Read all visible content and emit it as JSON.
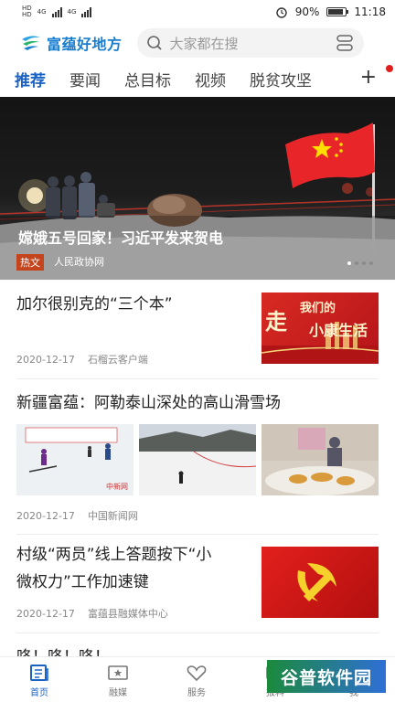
{
  "status_bar": {
    "left_tag_1": "HD",
    "left_tag_2": "HD",
    "left_net_1": "4G",
    "left_net_2": "4G",
    "battery": "90%",
    "time": "11:18"
  },
  "app": {
    "logo_text": "富蕴好地方",
    "search_placeholder": "大家都在搜",
    "icons": {
      "logo": "app-logo",
      "search": "search-icon",
      "scan": "scan-icon"
    }
  },
  "tabs": [
    {
      "label": "推荐",
      "active": true
    },
    {
      "label": "要闻",
      "active": false
    },
    {
      "label": "总目标",
      "active": false
    },
    {
      "label": "视频",
      "active": false
    },
    {
      "label": "脱贫攻坚",
      "active": false
    }
  ],
  "tabs_more": "+",
  "hero": {
    "title": "嫦娥五号回家！习近平发来贺电",
    "tag": "热文",
    "source": "人民政协网",
    "slides": 4,
    "active_slide": 1
  },
  "articles": [
    {
      "title": "加尔很别克的“三个本”",
      "date": "2020-12-17",
      "source": "石榴云客户端",
      "image_text_1": "走",
      "image_text_2": "我们的",
      "image_text_3": "小康生活"
    },
    {
      "title": "新疆富蕴：阿勒泰山深处的高山滑雪场",
      "date": "2020-12-17",
      "source": "中国新闻网",
      "image_caption": "中新网"
    },
    {
      "title_line1": "村级“两员”线上答题按下“小",
      "title_line2": "微权力”工作加速键",
      "date": "2020-12-17",
      "source": "富蕴县融媒体中心"
    },
    {
      "title": "咚！咚！咚！"
    }
  ],
  "bottom_nav": [
    {
      "label": "首页",
      "icon": "home-news-icon",
      "active": true
    },
    {
      "label": "融媒",
      "icon": "media-icon",
      "active": false
    },
    {
      "label": "服务",
      "icon": "service-icon",
      "active": false
    },
    {
      "label": "报料",
      "icon": "report-icon",
      "active": false
    },
    {
      "label": "我",
      "icon": "profile-icon",
      "active": false
    }
  ],
  "watermark": "谷普软件园",
  "colors": {
    "accent": "#1a63c4",
    "brand": "#1a7fd0",
    "tag": "#c5441c",
    "flag_red": "#e8262a"
  }
}
